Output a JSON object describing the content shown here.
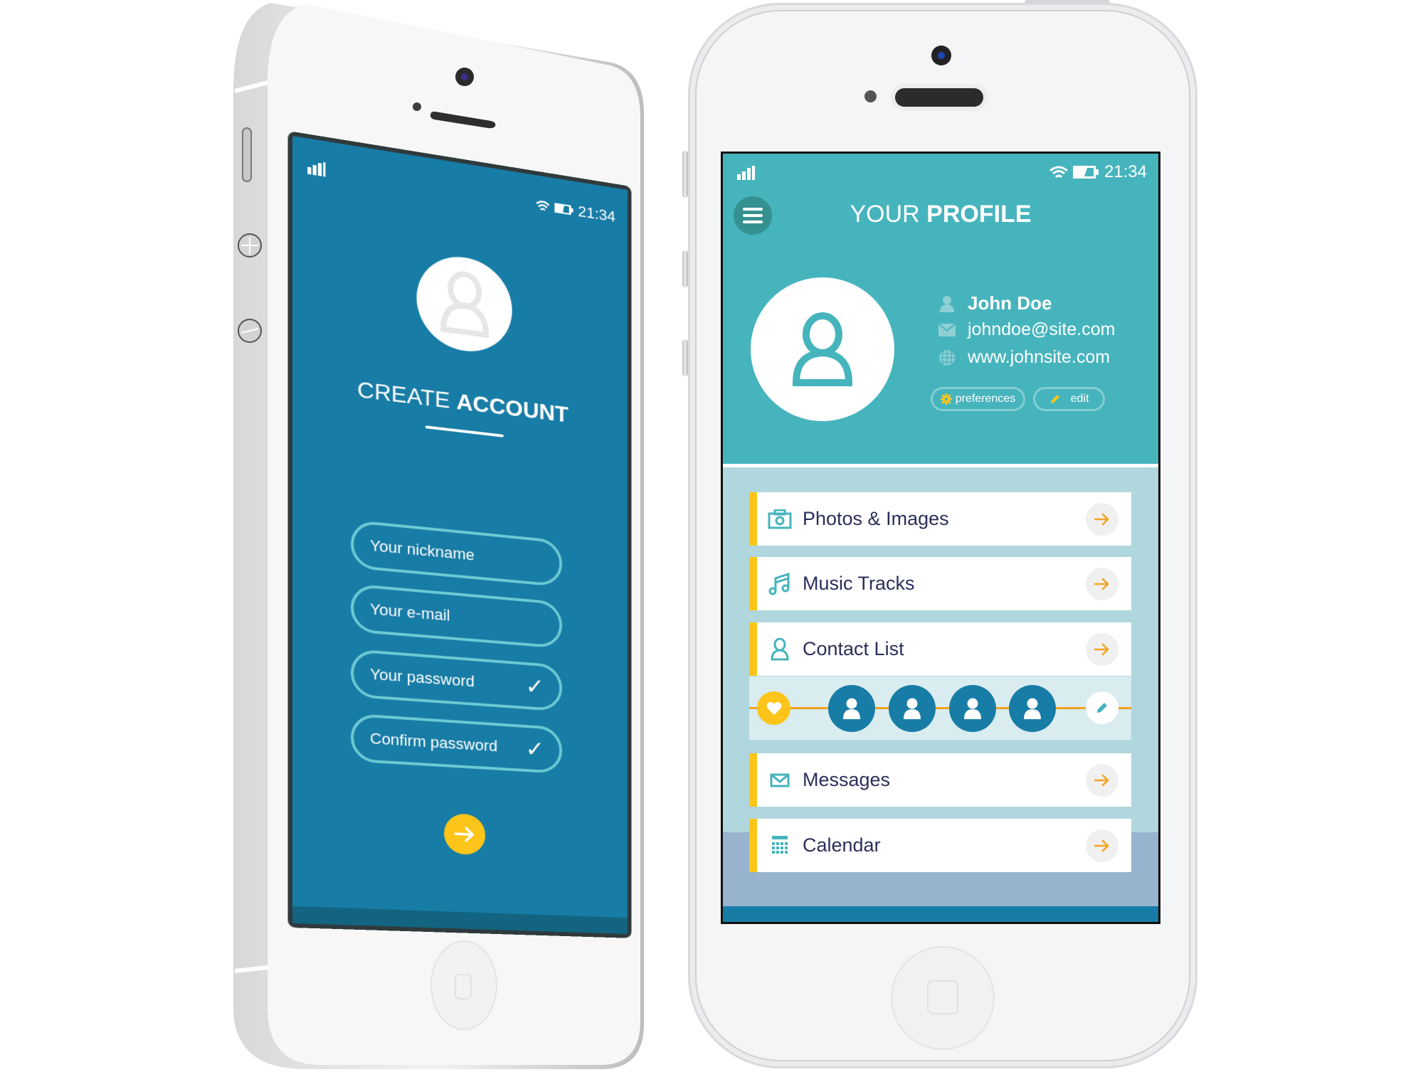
{
  "left_phone": {
    "status": {
      "signal_icon": "signal-bars-icon",
      "wifi_icon": "wifi-icon",
      "battery_icon": "battery-icon",
      "time": "21:34"
    },
    "avatar_icon": "user-outline-icon",
    "title_light": "CREATE ",
    "title_bold": "ACCOUNT",
    "fields": [
      {
        "placeholder": "Your nickname",
        "value": "",
        "validated": false
      },
      {
        "placeholder": "Your e-mail",
        "value": "",
        "validated": false
      },
      {
        "placeholder": "Your password",
        "value": "",
        "validated": true,
        "check": "✓"
      },
      {
        "placeholder": "Confirm password",
        "value": "",
        "validated": true,
        "check": "✓"
      }
    ],
    "submit_icon": "arrow-right-icon",
    "colors": {
      "screen_bg": "#177ca6",
      "field_border": "#6ccad3",
      "accent": "#fdc51a"
    }
  },
  "right_phone": {
    "status": {
      "signal_icon": "signal-bars-icon",
      "wifi_icon": "wifi-icon",
      "battery_icon": "battery-icon",
      "time": "21:34"
    },
    "menu_icon": "hamburger-menu-icon",
    "title_light": "YOUR ",
    "title_bold": "PROFILE",
    "profile": {
      "name": "John Doe",
      "email": "johndoe@site.com",
      "website": "www.johnsite.com"
    },
    "buttons": {
      "preferences": "preferences",
      "edit": "edit"
    },
    "menu_items": [
      {
        "label": "Photos & Images",
        "icon": "camera-icon"
      },
      {
        "label": "Music Tracks",
        "icon": "music-note-icon"
      },
      {
        "label": "Contact List",
        "icon": "user-icon"
      },
      {
        "label": "Messages",
        "icon": "envelope-icon"
      },
      {
        "label": "Calendar",
        "icon": "calendar-icon"
      }
    ],
    "contacts_strip": {
      "favorite_icon": "heart-icon",
      "contact_count": 4,
      "edit_icon": "pencil-icon"
    },
    "colors": {
      "header_bg": "#46b4bd",
      "list_bg": "#afd7dd",
      "accent": "#fdc51a",
      "arrow": "#f1a321",
      "text": "#2b2f5a",
      "avatar_bg": "#177ca6"
    }
  }
}
